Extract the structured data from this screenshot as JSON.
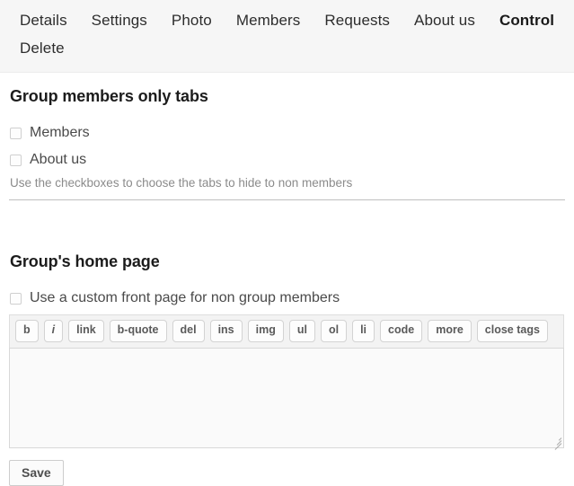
{
  "nav": {
    "items": [
      {
        "label": "Details",
        "current": false
      },
      {
        "label": "Settings",
        "current": false
      },
      {
        "label": "Photo",
        "current": false
      },
      {
        "label": "Members",
        "current": false
      },
      {
        "label": "Requests",
        "current": false
      },
      {
        "label": "About us",
        "current": false
      },
      {
        "label": "Control",
        "current": true
      },
      {
        "label": "Delete",
        "current": false
      }
    ]
  },
  "members_only": {
    "title": "Group members only tabs",
    "checkboxes": [
      {
        "label": "Members",
        "checked": false
      },
      {
        "label": "About us",
        "checked": false
      }
    ],
    "helper": "Use the checkboxes to choose the tabs to hide to non members"
  },
  "home_page": {
    "title": "Group's home page",
    "custom_front_page": {
      "label": "Use a custom front page for non group members",
      "checked": false
    },
    "toolbar_buttons": [
      "b",
      "i",
      "link",
      "b-quote",
      "del",
      "ins",
      "img",
      "ul",
      "ol",
      "li",
      "code",
      "more",
      "close tags"
    ],
    "textarea_value": "",
    "textarea_placeholder": ""
  },
  "save_label": "Save",
  "colors": {
    "nav_background": "#f6f6f6",
    "heading": "#1c1c1c",
    "body_text": "#4a4a4a",
    "helper_text": "#8b8b8b",
    "toolbar_background": "#f3f3f3",
    "button_border": "#d3d3d3",
    "divider": "#bfbfbf"
  }
}
